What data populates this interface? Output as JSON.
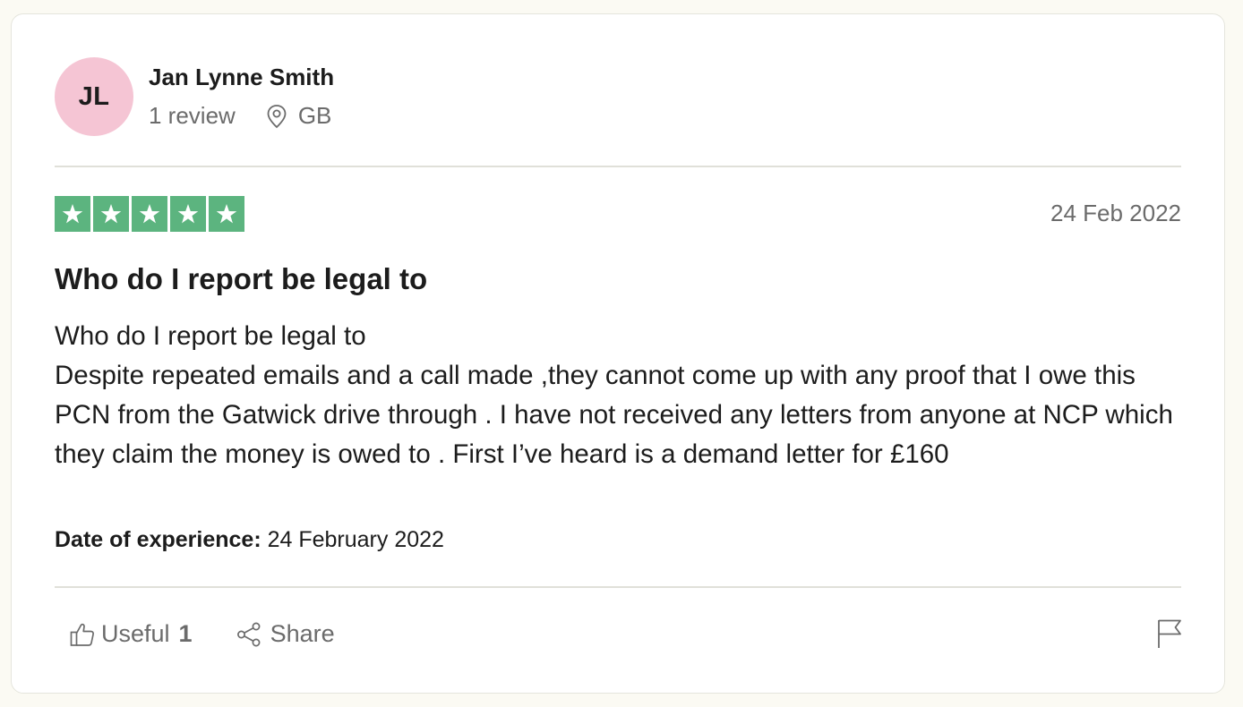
{
  "reviewer": {
    "initials": "JL",
    "name": "Jan Lynne Smith",
    "review_count": "1 review",
    "country": "GB",
    "avatar_color": "#f5c5d4"
  },
  "review": {
    "rating": 5,
    "rating_max": 5,
    "star_color": "#5cb47f",
    "date": "24 Feb 2022",
    "title": "Who do I report be legal to",
    "body_lines": [
      "Who do I report be legal to",
      "Despite repeated emails and a call made ,they cannot come up with any proof that I owe this PCN from the Gatwick drive through . I have not received any letters from anyone at NCP which they claim the money is owed to . First I’ve heard is a demand letter for £160"
    ],
    "experience_label": "Date of experience:",
    "experience_date": "24 February 2022"
  },
  "actions": {
    "useful_label": "Useful",
    "useful_count": "1",
    "share_label": "Share",
    "useful_icon": "thumbs-up-icon",
    "share_icon": "share-icon",
    "flag_icon": "flag-icon"
  }
}
